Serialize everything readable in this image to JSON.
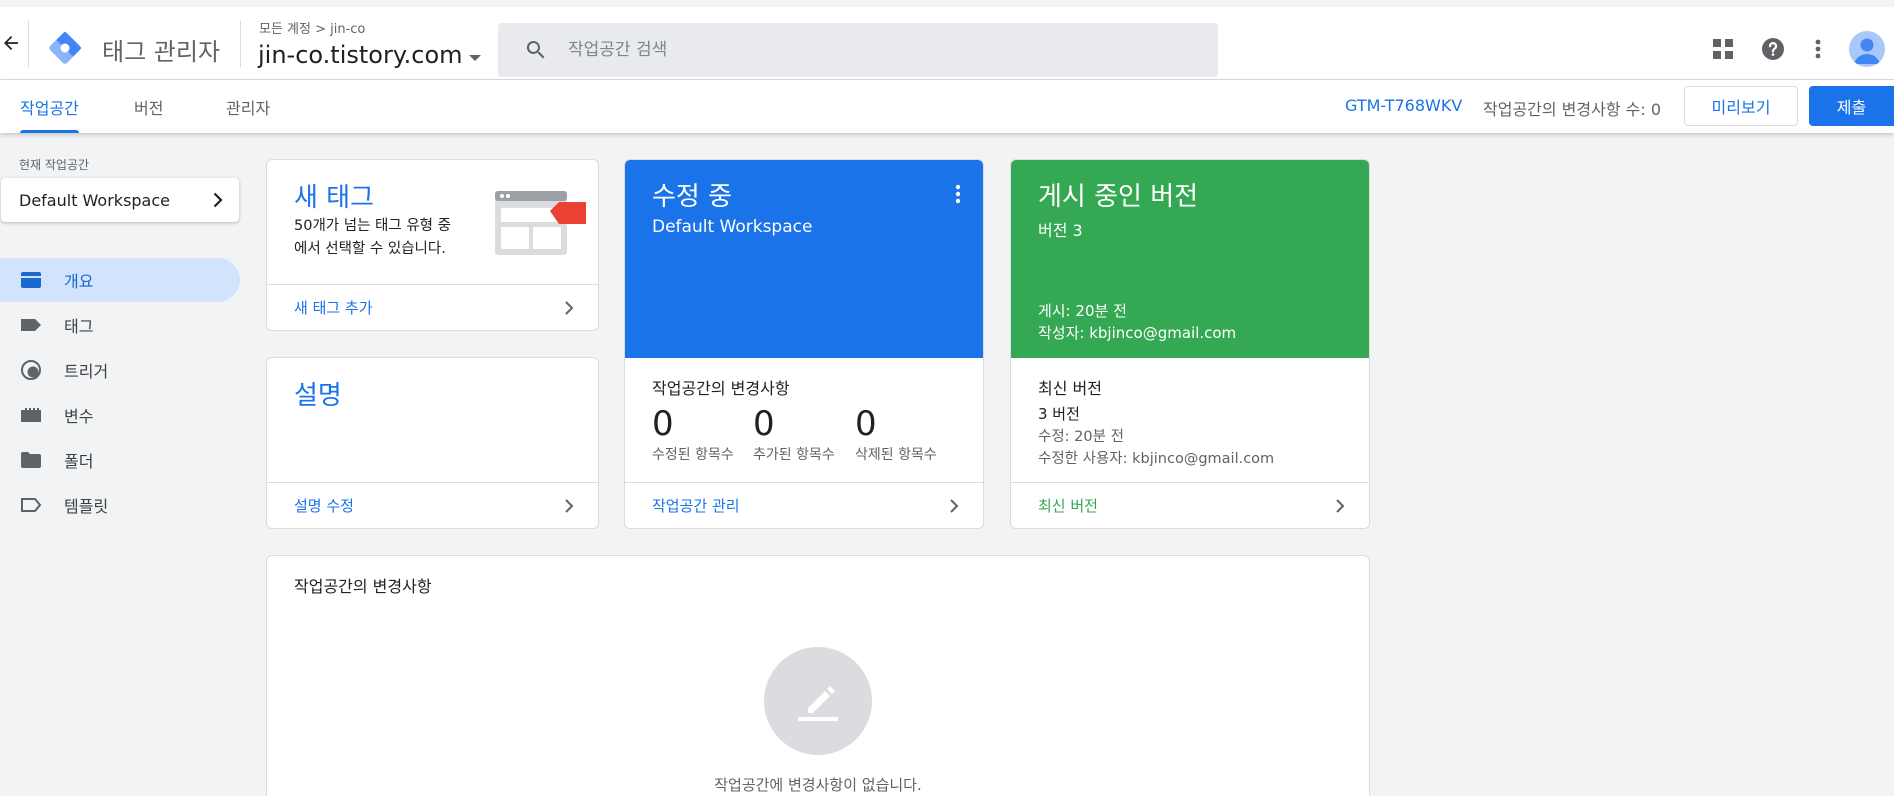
{
  "header": {
    "product_name": "태그 관리자",
    "account_crumb": "모든 계정 > jin-co",
    "container_name": "jin-co.tistory.com",
    "search_placeholder": "작업공간 검색"
  },
  "tabs": [
    {
      "label": "작업공간",
      "active": true
    },
    {
      "label": "버전",
      "active": false
    },
    {
      "label": "관리자",
      "active": false
    }
  ],
  "subbar": {
    "gtm_id": "GTM-T768WKV",
    "change_count": "작업공간의 변경사항 수: 0",
    "preview_label": "미리보기",
    "submit_label": "제출"
  },
  "sidebar": {
    "workspace_label": "현재 작업공간",
    "workspace_name": "Default Workspace",
    "items": [
      {
        "label": "개요",
        "icon": "overview-icon",
        "active": true
      },
      {
        "label": "태그",
        "icon": "tag-icon",
        "active": false
      },
      {
        "label": "트리거",
        "icon": "trigger-icon",
        "active": false
      },
      {
        "label": "변수",
        "icon": "variable-icon",
        "active": false
      },
      {
        "label": "폴더",
        "icon": "folder-icon",
        "active": false
      },
      {
        "label": "템플릿",
        "icon": "template-icon",
        "active": false
      }
    ]
  },
  "new_tag_card": {
    "title": "새 태그",
    "description": "50개가 넘는 태그 유형 중에서 선택할 수 있습니다.",
    "action": "새 태그 추가"
  },
  "description_card": {
    "title": "설명",
    "action": "설명 수정"
  },
  "editing_card": {
    "title": "수정 중",
    "workspace": "Default Workspace",
    "section_title": "작업공간의 변경사항",
    "stats": [
      {
        "value": "0",
        "label": "수정된 항목수"
      },
      {
        "value": "0",
        "label": "추가된 항목수"
      },
      {
        "value": "0",
        "label": "삭제된 항목수"
      }
    ],
    "action": "작업공간 관리",
    "color": "#1a73e8"
  },
  "published_card": {
    "title": "게시 중인 버전",
    "version": "버전 3",
    "published": "게시: 20분 전",
    "author": "작성자: kbjinco@gmail.com",
    "latest_title": "최신 버전",
    "latest_version": "3 버전",
    "modified": "수정: 20분 전",
    "modified_by": "수정한 사용자: kbjinco@gmail.com",
    "action": "최신 버전",
    "color": "#34a853"
  },
  "changes_panel": {
    "title": "작업공간의 변경사항",
    "empty_text": "작업공간에 변경사항이 없습니다."
  }
}
